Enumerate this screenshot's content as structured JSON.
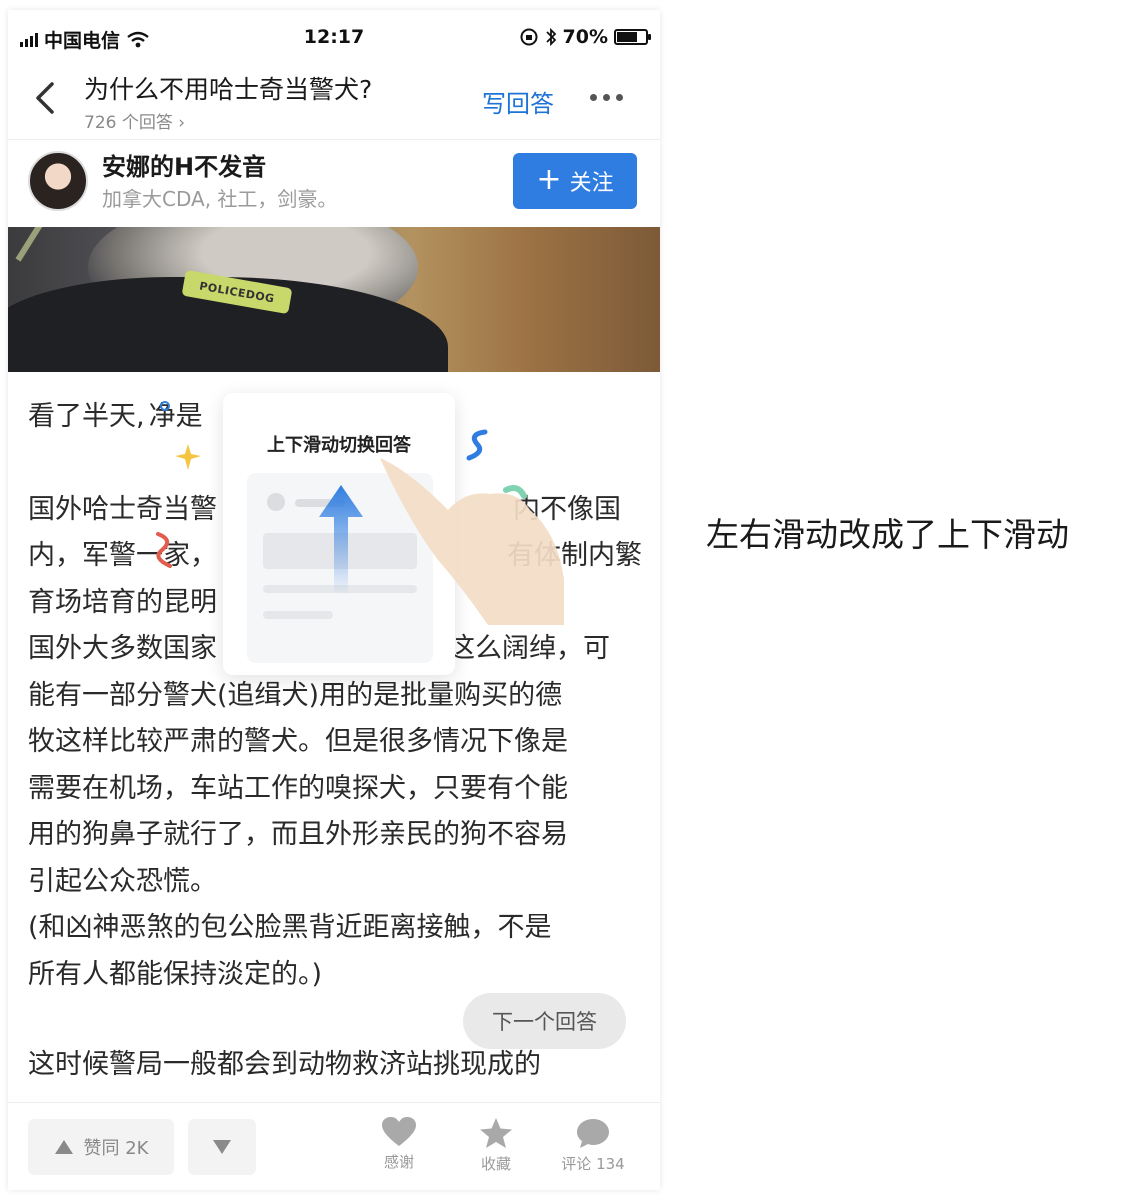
{
  "status_bar": {
    "carrier": "中国电信",
    "time": "12:17",
    "battery_percent": 70,
    "battery_label": "70%"
  },
  "nav": {
    "question_title": "为什么不用哈士奇当警犬?",
    "answer_count": "726 个回答 ›",
    "write_answer": "写回答",
    "back_icon": "chevron-left-icon",
    "more_icon": "more-dots-icon"
  },
  "author": {
    "name": "安娜的H不发音",
    "bio": "加拿大CDA, 社工，剑豪。",
    "follow_label": "关注",
    "follow_color": "#2f7de1"
  },
  "banner": {
    "patch_text": "POLICEDOG"
  },
  "swipe_guide": {
    "label": "上下滑动切换回答",
    "arrow_color": "#2f7de1"
  },
  "article": {
    "lines": [
      "看了半天,",
      "净是",
      "国外哈士奇当警",
      "内不像国",
      "内，军警一家，",
      "有体制内繁",
      "育场培育的昆明",
      "国外大多数国家",
      "有这么阔绰，可",
      "能有一部分警犬(追缉犬)用的是批量购买的德",
      "牧这样比较严肃的警犬。但是很多情况下像是",
      "需要在机场，车站工作的嗅探犬，只要有个能",
      "用的狗鼻子就行了，而且外形亲民的狗不容易",
      "引起公众恐慌。",
      "(和凶神恶煞的包公脸黑背近距离接触，不是",
      "所有人都能保持淡定的。)",
      "这时候警局一般都会到动物救济站挑现成的"
    ]
  },
  "next_answer": "下一个回答",
  "bottom_bar": {
    "upvote_label": "赞同 2K",
    "thanks_label": "感谢",
    "favorite_label": "收藏",
    "comment_label": "评论 134"
  },
  "annotation": "左右滑动改成了上下滑动"
}
